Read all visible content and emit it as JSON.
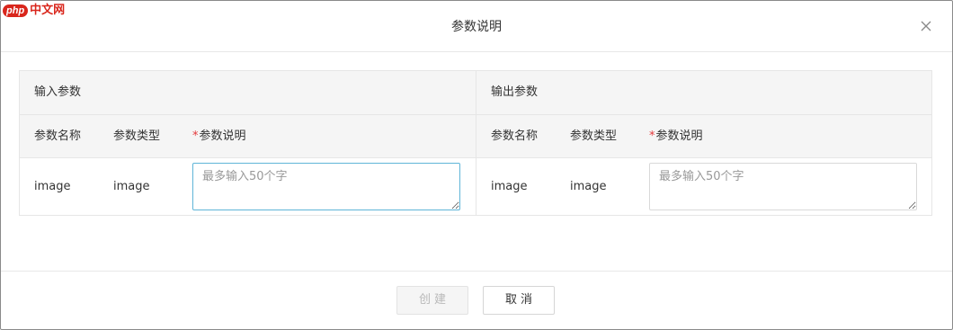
{
  "watermark": {
    "badge": "php",
    "text": "中文网"
  },
  "dialog": {
    "title": "参数说明",
    "close_icon": "close-icon"
  },
  "input_section": {
    "title": "输入参数",
    "columns": {
      "name": "参数名称",
      "type": "参数类型",
      "required_mark": "*",
      "desc": "参数说明"
    },
    "rows": [
      {
        "name": "image",
        "type": "image",
        "desc_value": "",
        "desc_placeholder": "最多输入50个字"
      }
    ]
  },
  "output_section": {
    "title": "输出参数",
    "columns": {
      "name": "参数名称",
      "type": "参数类型",
      "required_mark": "*",
      "desc": "参数说明"
    },
    "rows": [
      {
        "name": "image",
        "type": "image",
        "desc_value": "",
        "desc_placeholder": "最多输入50个字"
      }
    ]
  },
  "footer": {
    "create_label": "创建",
    "cancel_label": "取消",
    "create_disabled": true
  },
  "colors": {
    "required": "#e4393c",
    "focus_border": "#5fb5d8",
    "header_bg": "#f5f5f5",
    "watermark": "#d9261c"
  }
}
